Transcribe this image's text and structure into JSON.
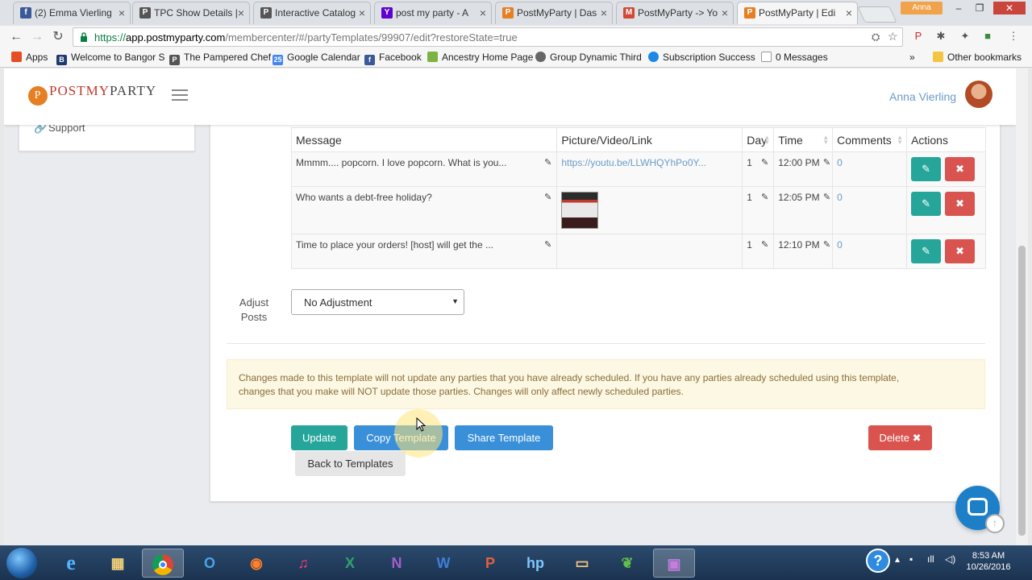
{
  "browser": {
    "tabs": [
      {
        "label": "(2) Emma Vierling",
        "fav": "f",
        "color": "#3b5998"
      },
      {
        "label": "TPC Show Details |",
        "fav": "P",
        "color": "#555555"
      },
      {
        "label": "Interactive Catalog",
        "fav": "P",
        "color": "#555555"
      },
      {
        "label": "post my party - A",
        "fav": "Y",
        "color": "#6001d2"
      },
      {
        "label": "PostMyParty | Das",
        "fav": "P",
        "color": "#e67e22"
      },
      {
        "label": "PostMyParty -> Yo",
        "fav": "M",
        "color": "#d14836"
      },
      {
        "label": "PostMyParty | Edi",
        "fav": "P",
        "color": "#e67e22"
      }
    ],
    "profile_name": "Anna",
    "url_scheme": "https://",
    "url_host": "app.postmyparty.com",
    "url_path": "/membercenter/#/partyTemplates/99907/edit?restoreState=true",
    "bookmarks": [
      {
        "label": "Apps",
        "icon": "apps-grid-icon",
        "color": "#e44d26"
      },
      {
        "label": "Welcome to Bangor S",
        "icon": "B",
        "color": "#1f3a6e"
      },
      {
        "label": "The Pampered Chef",
        "icon": "P",
        "color": "#555555"
      },
      {
        "label": "Google Calendar",
        "icon": "25",
        "color": "#4285f4"
      },
      {
        "label": "Facebook",
        "icon": "f",
        "color": "#3b5998"
      },
      {
        "label": "Ancestry Home Page",
        "icon": "leaf-icon",
        "color": "#7cb342"
      },
      {
        "label": "Group Dynamic Third",
        "icon": "globe-icon",
        "color": "#666666"
      },
      {
        "label": "Subscription Success",
        "icon": "circle-icon",
        "color": "#1e88e5"
      },
      {
        "label": "0 Messages",
        "icon": "page-icon",
        "color": "#999999"
      }
    ],
    "bookmarks_overflow": "»",
    "other_bookmarks": "Other bookmarks"
  },
  "app": {
    "logo_post": "POST",
    "logo_my": "MY",
    "logo_party": "PARTY",
    "user_name": "Anna Vierling",
    "sidebar_support": "Support"
  },
  "posts_table": {
    "headers": [
      "Message",
      "Picture/Video/Link",
      "Day",
      "Time",
      "Comments",
      "Actions"
    ],
    "rows": [
      {
        "message": "Mmmm.... popcorn. I love popcorn. What is you...",
        "media_link": "https://youtu.be/LLWHQYhPo0Y...",
        "day": "1",
        "time": "12:00 PM",
        "comments": "0"
      },
      {
        "message": "Who wants a debt-free holiday?",
        "media_link": "",
        "day": "1",
        "time": "12:05 PM",
        "comments": "0"
      },
      {
        "message": "Time to place your orders! [host] will get the ...",
        "media_link": "",
        "day": "1",
        "time": "12:10 PM",
        "comments": "0"
      }
    ]
  },
  "adjust": {
    "label_line1": "Adjust",
    "label_line2": "Posts",
    "selected": "No Adjustment"
  },
  "alert_line1": "Changes made to this template will not update any parties that you have already scheduled. If you have any parties already scheduled using this template,",
  "alert_line2": "changes that you make will NOT update those parties. Changes will only affect newly scheduled parties.",
  "buttons": {
    "update": "Update",
    "copy": "Copy Template",
    "share": "Share Template",
    "delete": "Delete",
    "back": "Back to Templates"
  },
  "taskbar": {
    "time": "8:53 AM",
    "date": "10/26/2016"
  }
}
